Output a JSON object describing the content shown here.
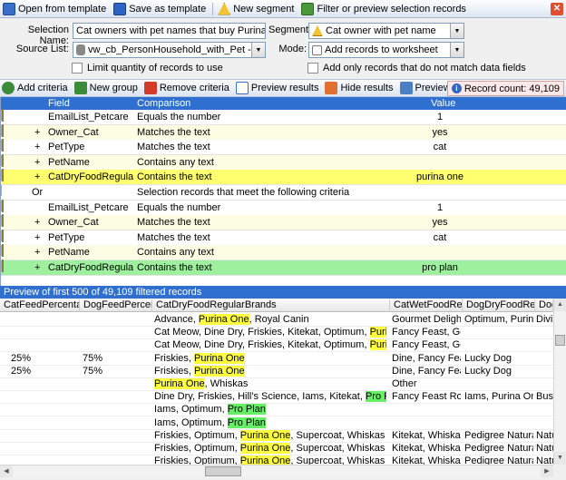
{
  "toolbar": {
    "open_label": "Open from template",
    "save_label": "Save as template",
    "new_segment_label": "New segment",
    "filter_label": "Filter or preview selection records"
  },
  "form": {
    "selection_name_label": "Selection Name:",
    "selection_name_value": "Cat owners with pet names that buy Purina One & Pro",
    "segment_label": "Segment:",
    "segment_value": "Cat owner with pet name",
    "source_list_label": "Source List:",
    "source_list_value": "vw_cb_PersonHousehold_with_Pet - Sim..",
    "mode_label": "Mode:",
    "mode_value": "Add records to worksheet",
    "limit_label": "Limit quantity of records to use",
    "add_only_label": "Add only records that do not match data fields"
  },
  "criteria_toolbar": {
    "add_label": "Add criteria",
    "new_group_label": "New group",
    "remove_label": "Remove criteria",
    "preview_label": "Preview results",
    "hide_label": "Hide results",
    "waterfall_label": "Preview waterfall",
    "record_count": "Record count: 49,109"
  },
  "criteria_grid": {
    "headers": {
      "field": "Field",
      "comparison": "Comparison",
      "value": "Value"
    },
    "rows": [
      {
        "op": "",
        "field": "EmailList_Petcare",
        "comparison": "Equals the number",
        "value": "1"
      },
      {
        "op": "+",
        "field": "Owner_Cat",
        "comparison": "Matches the text",
        "value": "yes"
      },
      {
        "op": "+",
        "field": "PetType",
        "comparison": "Matches the text",
        "value": "cat"
      },
      {
        "op": "+",
        "field": "PetName",
        "comparison": "Contains any text",
        "value": ""
      },
      {
        "op": "+",
        "field": "CatDryFoodRegularB...",
        "comparison": "Contains the text",
        "value": "purina one"
      },
      {
        "op": "Or",
        "field": "",
        "comparison": "Selection records that meet the following criteria",
        "value": ""
      },
      {
        "op": "",
        "field": "EmailList_Petcare",
        "comparison": "Equals the number",
        "value": "1"
      },
      {
        "op": "+",
        "field": "Owner_Cat",
        "comparison": "Matches the text",
        "value": "yes"
      },
      {
        "op": "+",
        "field": "PetType",
        "comparison": "Matches the text",
        "value": "cat"
      },
      {
        "op": "+",
        "field": "PetName",
        "comparison": "Contains any text",
        "value": ""
      },
      {
        "op": "+",
        "field": "CatDryFoodRegularB...",
        "comparison": "Contains the text",
        "value": "pro plan"
      }
    ]
  },
  "preview": {
    "title": "Preview of first 500 of 49,109 filtered records",
    "headers": [
      "CatFeedPercentag",
      "DogFeedPercenta",
      "CatDryFoodRegularBrands",
      "CatWetFoodRegi",
      "DogDryFoodRegul",
      "Dog"
    ],
    "rows": [
      {
        "c1": "",
        "c2": "",
        "brands": [
          [
            "Advance, ",
            ""
          ],
          [
            "Purina One",
            "y"
          ],
          [
            ", Royal Canin",
            ""
          ]
        ],
        "c4": "Gourmet Delight,",
        "c5": "Optimum, Purina",
        "c6": "Divin"
      },
      {
        "c1": "",
        "c2": "",
        "brands": [
          [
            "Cat Meow, Dine Dry, Friskies, Kitekat, Optimum, ",
            ""
          ],
          [
            "Purina One",
            "y"
          ],
          [
            ", Wh",
            ""
          ]
        ],
        "c4": "Fancy Feast, Gour",
        "c5": "",
        "c6": ""
      },
      {
        "c1": "",
        "c2": "",
        "brands": [
          [
            "Cat Meow, Dine Dry, Friskies, Kitekat, Optimum, ",
            ""
          ],
          [
            "Purina One",
            "y"
          ],
          [
            ", Wh",
            ""
          ]
        ],
        "c4": "Fancy Feast, Gour",
        "c5": "",
        "c6": ""
      },
      {
        "c1": "25%",
        "c2": "75%",
        "brands": [
          [
            "Friskies, ",
            ""
          ],
          [
            "Purina One",
            "y"
          ]
        ],
        "c4": "Dine, Fancy Feast,",
        "c5": "Lucky Dog",
        "c6": ""
      },
      {
        "c1": "25%",
        "c2": "75%",
        "brands": [
          [
            "Friskies, ",
            ""
          ],
          [
            "Purina One",
            "y"
          ]
        ],
        "c4": "Dine, Fancy Feast,",
        "c5": "Lucky Dog",
        "c6": ""
      },
      {
        "c1": "",
        "c2": "",
        "brands": [
          [
            "Purina One",
            "y"
          ],
          [
            ", Whiskas",
            ""
          ]
        ],
        "c4": "Other",
        "c5": "",
        "c6": ""
      },
      {
        "c1": "",
        "c2": "",
        "brands": [
          [
            "Dine Dry, Friskies, Hill's Science, Iams, Kitekat, ",
            ""
          ],
          [
            "Pro Plan",
            "g"
          ],
          [
            ", Whisk",
            ""
          ]
        ],
        "c4": "Fancy Feast Royal",
        "c5": "Iams, Purina One,",
        "c6": "Busl"
      },
      {
        "c1": "",
        "c2": "",
        "brands": [
          [
            "Iams, Optimum, ",
            ""
          ],
          [
            "Pro Plan",
            "g"
          ]
        ],
        "c4": "",
        "c5": "",
        "c6": ""
      },
      {
        "c1": "",
        "c2": "",
        "brands": [
          [
            "Iams, Optimum, ",
            ""
          ],
          [
            "Pro Plan",
            "g"
          ]
        ],
        "c4": "",
        "c5": "",
        "c6": ""
      },
      {
        "c1": "",
        "c2": "",
        "brands": [
          [
            "Friskies, Optimum, ",
            ""
          ],
          [
            "Purina One",
            "y"
          ],
          [
            ", Supercoat, Whiskas",
            ""
          ]
        ],
        "c4": "Kitekat, Whiskas,",
        "c5": "Pedigree Naturals,",
        "c6": "Natu"
      },
      {
        "c1": "",
        "c2": "",
        "brands": [
          [
            "Friskies, Optimum, ",
            ""
          ],
          [
            "Purina One",
            "y"
          ],
          [
            ", Supercoat, Whiskas",
            ""
          ]
        ],
        "c4": "Kitekat, Whiskas,",
        "c5": "Pedigree Naturals,",
        "c6": "Natu"
      },
      {
        "c1": "",
        "c2": "",
        "brands": [
          [
            "Friskies, Optimum, ",
            ""
          ],
          [
            "Purina One",
            "y"
          ],
          [
            ", Supercoat, Whiskas",
            ""
          ]
        ],
        "c4": "Kitekat, Whiskas,",
        "c5": "Pedigree Naturals,",
        "c6": "Natu"
      }
    ]
  },
  "colors": {
    "accent": "#2f6fd0",
    "highlight_yellow": "#ffff40",
    "highlight_green": "#66ee66"
  }
}
